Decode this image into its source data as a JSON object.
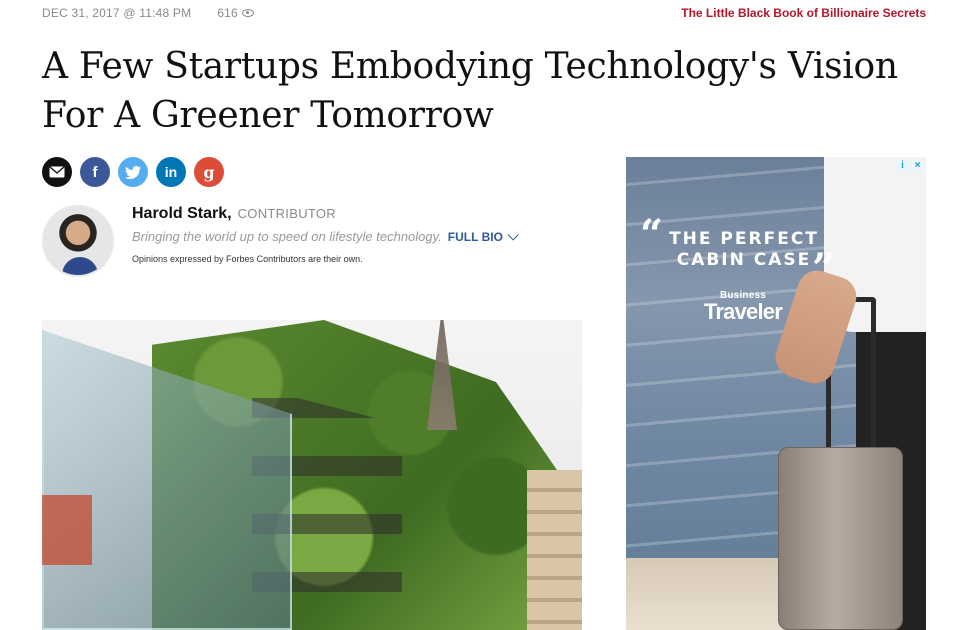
{
  "meta": {
    "date": "DEC 31, 2017 @ 11:48 PM",
    "views": "616"
  },
  "promo_link": "The Little Black Book of Billionaire Secrets",
  "article": {
    "headline": "A Few Startups Embodying Technology's Vision For A Greener Tomorrow"
  },
  "share": {
    "email_icon": "envelope-icon",
    "facebook_glyph": "f",
    "twitter_icon": "twitter-bird-icon",
    "linkedin_glyph": "in",
    "googleplus_glyph": "g"
  },
  "author": {
    "name": "Harold Stark",
    "separator": ",",
    "role": "CONTRIBUTOR",
    "bio": "Bringing the world up to speed on lifestyle technology.",
    "full_bio_label": "FULL BIO",
    "disclaimer": "Opinions expressed by Forbes Contributors are their own."
  },
  "ad": {
    "quote_open": "“",
    "quote_close": "”",
    "line1": "THE PERFECT",
    "line2": "CABIN CASE",
    "brand_small": "Business",
    "brand_big": "Traveler",
    "adchoice_info": "i",
    "adchoice_close": "×"
  },
  "colors": {
    "promo_red": "#b3162a",
    "full_bio_blue": "#2d5a9b",
    "facebook": "#3b5998",
    "twitter": "#55acee",
    "linkedin": "#0077b5",
    "googleplus": "#dd4b39"
  }
}
